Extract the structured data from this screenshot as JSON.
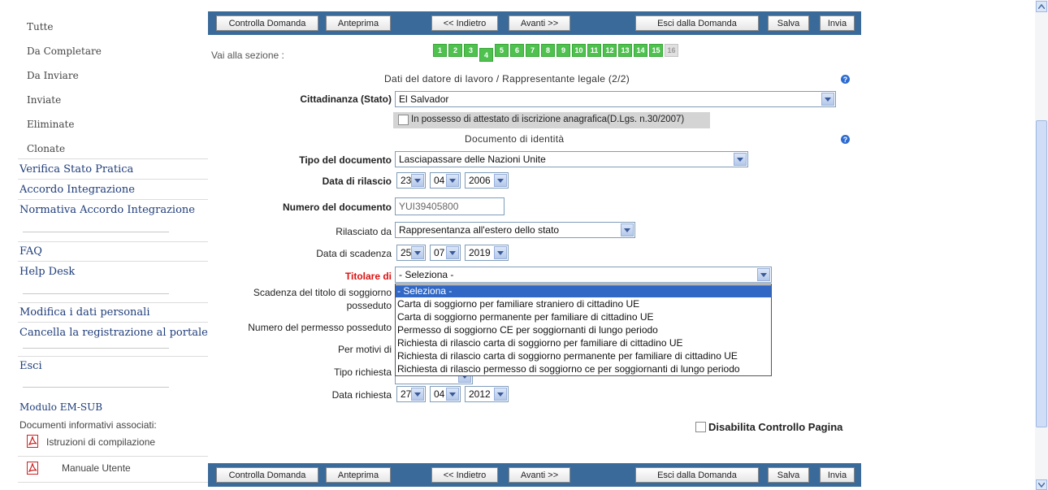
{
  "sidebar": {
    "sub_items": [
      "Tutte",
      "Da Completare",
      "Da Inviare",
      "Inviate",
      "Eliminate",
      "Clonate"
    ],
    "links1": [
      "Verifica Stato Pratica",
      "Accordo Integrazione",
      "Normativa Accordo Integrazione"
    ],
    "links2": [
      "FAQ",
      "Help Desk"
    ],
    "links3": [
      "Modifica i dati personali",
      "Cancella la registrazione al portale"
    ],
    "esci": "Esci",
    "modulo": "Modulo EM-SUB",
    "documenti_label": "Documenti informativi associati:",
    "docs": [
      "Istruzioni di compilazione",
      "Manuale Utente"
    ]
  },
  "toolbar": {
    "controlla": "Controlla Domanda",
    "anteprima": "Anteprima",
    "indietro": "<< Indietro",
    "avanti": "Avanti >>",
    "esci": "Esci dalla Domanda",
    "salva": "Salva",
    "invia": "Invia"
  },
  "nav": {
    "label": "Vai alla sezione :",
    "sections": [
      "1",
      "2",
      "3",
      "4",
      "5",
      "6",
      "7",
      "8",
      "9",
      "10",
      "11",
      "12",
      "13",
      "14",
      "15",
      "16"
    ],
    "active": "4",
    "disabled": "16"
  },
  "form": {
    "section1_title": "Dati del datore di lavoro / Rappresentante legale (2/2)",
    "cittadinanza_label": "Cittadinanza (Stato)",
    "cittadinanza_value": "El Salvador",
    "attestato_label": "In possesso di attestato di iscrizione anagrafica(D.Lgs. n.30/2007)",
    "section2_title": "Documento di identità",
    "tipo_doc_label": "Tipo del documento",
    "tipo_doc_value": "Lasciapassare delle Nazioni Unite",
    "data_rilascio_label": "Data di rilascio",
    "data_rilascio": {
      "dd": "23",
      "mm": "04",
      "yyyy": "2006"
    },
    "numero_doc_label": "Numero del documento",
    "numero_doc_value": "YUI39405800",
    "rilasciato_label": "Rilasciato da",
    "rilasciato_value": "Rappresentanza all'estero dello stato",
    "data_scadenza_label": "Data di scadenza",
    "data_scadenza": {
      "dd": "25",
      "mm": "07",
      "yyyy": "2019"
    },
    "titolare_label": "Titolare di",
    "titolare_value": "- Seleziona -",
    "scadenza_titolo_label_1": "Scadenza del titolo di soggiorno",
    "scadenza_titolo_label_2": "posseduto",
    "numero_permesso_label": "Numero del permesso posseduto",
    "per_motivi_label": "Per motivi di",
    "tipo_richiesta_label": "Tipo richiesta",
    "data_richiesta_label": "Data richiesta",
    "data_richiesta": {
      "dd": "27",
      "mm": "04",
      "yyyy": "2012"
    },
    "disabilita_label": "Disabilita Controllo Pagina"
  },
  "dropdown": {
    "options": [
      "- Seleziona -",
      "Carta di soggiorno per familiare straniero di cittadino UE",
      "Carta di soggiorno permanente per familiare di cittadino UE",
      "Permesso di soggiorno CE per soggiornanti di lungo periodo",
      "Richiesta di rilascio carta di soggiorno per familiare di cittadino UE",
      "Richiesta di rilascio carta di soggiorno permanente per familiare di cittadino UE",
      "Richiesta di rilascio permesso di soggiorno ce per soggiornanti di lungo periodo"
    ],
    "highlighted": 0
  },
  "colors": {
    "toolbar": "#3a6a99",
    "section_green": "#4fc14f",
    "highlight": "#3168c5",
    "required_red": "#d11"
  }
}
